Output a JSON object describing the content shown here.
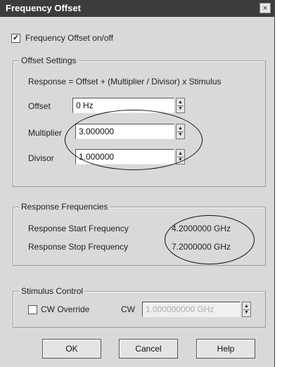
{
  "window": {
    "title": "Frequency Offset",
    "close_glyph": "×"
  },
  "freq_offset_toggle": {
    "label": "Frequency Offset on/off",
    "checked_glyph": "✓"
  },
  "offset_settings": {
    "title": "Offset Settings",
    "formula": "Response  =  Offset + (Multiplier / Divisor) x Stimulus",
    "offset": {
      "label": "Offset",
      "value": "0 Hz"
    },
    "multiplier": {
      "label": "Multiplier",
      "value": "3.000000"
    },
    "divisor": {
      "label": "Divisor",
      "value": "1.000000"
    }
  },
  "response_frequencies": {
    "title": "Response Frequencies",
    "start": {
      "label": "Response Start Frequency",
      "value": "4.2000000 GHz"
    },
    "stop": {
      "label": "Response Stop Frequency",
      "value": "7.2000000 GHz"
    }
  },
  "stimulus_control": {
    "title": "Stimulus Control",
    "cw_override": {
      "label": "CW Override",
      "checked": false
    },
    "cw": {
      "label": "CW",
      "value": "1.000000000 GHz"
    }
  },
  "buttons": {
    "ok": "OK",
    "cancel": "Cancel",
    "help": "Help"
  },
  "spinner_glyphs": {
    "up": "▲",
    "down": "▼"
  }
}
